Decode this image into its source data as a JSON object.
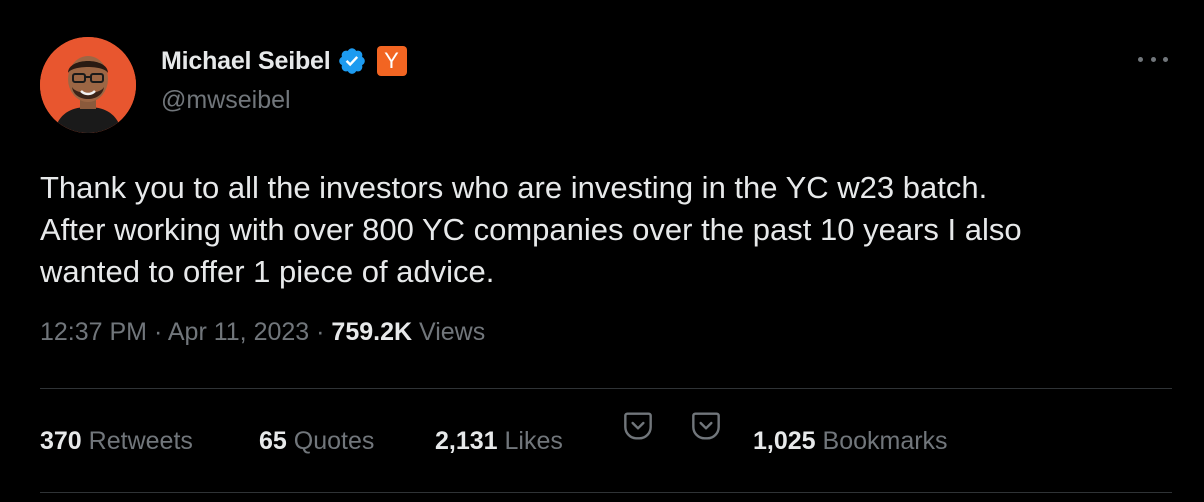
{
  "author": {
    "name": "Michael Seibel",
    "handle": "@mwseibel",
    "badge_label": "Y"
  },
  "more_icon": "more-horizontal-icon",
  "tweet": {
    "text": "Thank you to all the investors who are investing in the YC w23 batch.\nAfter working with over 800 YC companies over the past 10 years I also\nwanted to offer 1 piece of advice.",
    "time": "12:37 PM",
    "separator": "·",
    "date": "Apr 11, 2023",
    "views_count": "759.2K",
    "views_label": "Views"
  },
  "stats": {
    "retweets_count": "370",
    "retweets_label": "Retweets",
    "quotes_count": "65",
    "quotes_label": "Quotes",
    "likes_count": "2,131",
    "likes_label": "Likes",
    "bookmarks_count": "1,025",
    "bookmarks_label": "Bookmarks"
  },
  "colors": {
    "background": "#000000",
    "text_primary": "#e7e9ea",
    "text_secondary": "#71767b",
    "verified": "#1d9bf0",
    "yc_orange": "#f26522",
    "divider": "#2f3336"
  }
}
